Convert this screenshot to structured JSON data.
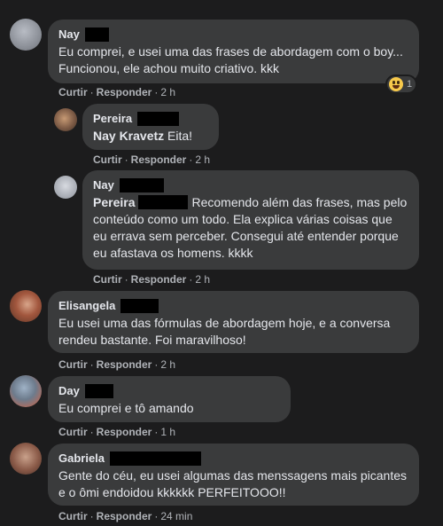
{
  "comments": [
    {
      "name": "Nay",
      "text": "Eu comprei, e usei uma das frases de abordagem com o boy... Funcionou, ele achou muito criativo. kkk",
      "like": "Curtir",
      "reply": "Responder",
      "time": "2 h",
      "reaction_count": "1",
      "reaction_icon": "laughing-emoji"
    },
    {
      "name": "Pereira",
      "tag": "Nay Kravetz",
      "text": "Eita!",
      "like": "Curtir",
      "reply": "Responder",
      "time": "2 h"
    },
    {
      "name": "Nay",
      "tag": "Pereira",
      "text": "Recomendo além das frases, mas pelo conteúdo como um todo. Ela explica várias coisas que eu errava sem perceber. Consegui até entender porque eu afastava os homens. kkkk",
      "like": "Curtir",
      "reply": "Responder",
      "time": "2 h"
    },
    {
      "name": "Elisangela",
      "text": "Eu usei uma das fórmulas de abordagem hoje, e a conversa rendeu bastante. Foi maravilhoso!",
      "like": "Curtir",
      "reply": "Responder",
      "time": "2 h"
    },
    {
      "name": "Day",
      "text": "Eu comprei e tô amando",
      "like": "Curtir",
      "reply": "Responder",
      "time": "1 h"
    },
    {
      "name": "Gabriela",
      "text": "Gente do céu, eu usei algumas das menssagens mais picantes e o ômi endoidou kkkkkk PERFEITOOO!!",
      "like": "Curtir",
      "reply": "Responder",
      "time": "24 min"
    }
  ],
  "colors": {
    "background": "#1c1c1d",
    "bubble": "#3a3b3c",
    "text": "#e4e6eb",
    "meta": "#b0b3b8"
  }
}
